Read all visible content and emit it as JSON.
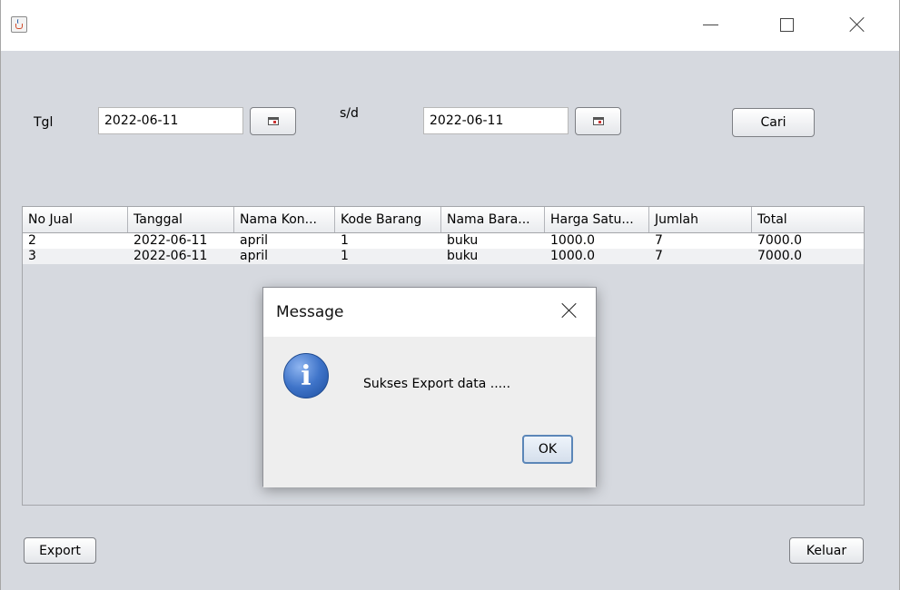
{
  "window": {
    "icon": "java-cup-icon"
  },
  "filter": {
    "tgl_label": "Tgl",
    "date_from": "2022-06-11",
    "sd_label": "s/d",
    "date_to": "2022-06-11",
    "search_button": "Cari"
  },
  "table": {
    "columns": [
      "No Jual",
      "Tanggal",
      "Nama Kon...",
      "Kode Barang",
      "Nama Bara...",
      "Harga Satu...",
      "Jumlah",
      "Total"
    ],
    "rows": [
      [
        "2",
        "2022-06-11",
        "april",
        "1",
        "buku",
        "1000.0",
        "7",
        "7000.0"
      ],
      [
        "3",
        "2022-06-11",
        "april",
        "1",
        "buku",
        "1000.0",
        "7",
        "7000.0"
      ]
    ]
  },
  "dialog": {
    "title": "Message",
    "message": "Sukses Export data .....",
    "ok_button": "OK",
    "icon": "info-icon"
  },
  "footer": {
    "export_button": "Export",
    "exit_button": "Keluar"
  }
}
